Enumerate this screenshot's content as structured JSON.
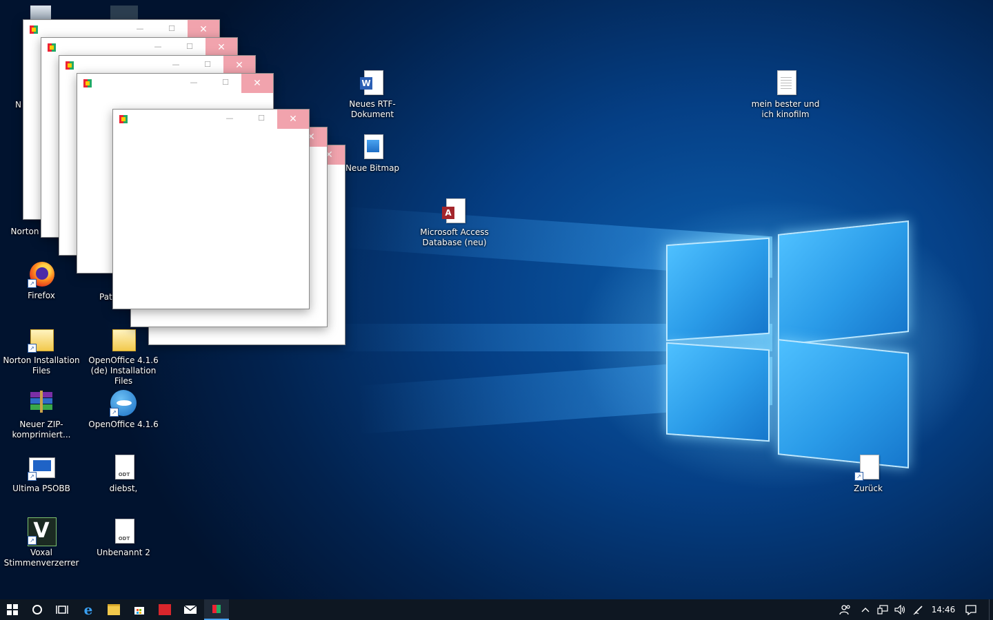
{
  "desktop": {
    "icons": [
      {
        "label": "N",
        "id": "norton-partial-top"
      },
      {
        "label": "Norton",
        "id": "norton"
      },
      {
        "label": "Firefox",
        "id": "firefox"
      },
      {
        "label": "Pati",
        "id": "pati"
      },
      {
        "label": "Norton Installation Files",
        "id": "norton-installation-files"
      },
      {
        "label": "OpenOffice 4.1.6 (de) Installation Files",
        "id": "openoffice-installation-files"
      },
      {
        "label": "Neuer ZIP-komprimiert...",
        "id": "zip"
      },
      {
        "label": "OpenOffice 4.1.6",
        "id": "openoffice"
      },
      {
        "label": "Ultima PSOBB",
        "id": "ultima-psobb"
      },
      {
        "label": "diebst,",
        "id": "diebst"
      },
      {
        "label": "Voxal Stimmenverzerrer",
        "id": "voxal"
      },
      {
        "label": "Unbenannt 2",
        "id": "unbenannt"
      },
      {
        "label": "Neues RTF-Dokument",
        "id": "rtf"
      },
      {
        "label": "Neue Bitmap",
        "id": "bitmap"
      },
      {
        "label": "Microsoft Access Database (neu)",
        "id": "access"
      },
      {
        "label": "mein bester und ich kinofilm",
        "id": "kinofilm"
      },
      {
        "label": "Zurück",
        "id": "zurueck"
      }
    ],
    "odt_badge": "ODT"
  },
  "windows": {
    "minimize_glyph": "—",
    "maximize_glyph": "☐",
    "close_glyph": "✕"
  },
  "taskbar": {
    "clock": "14:46",
    "colors": {
      "background": "#0e1722",
      "accent": "#4aa3f0"
    }
  }
}
